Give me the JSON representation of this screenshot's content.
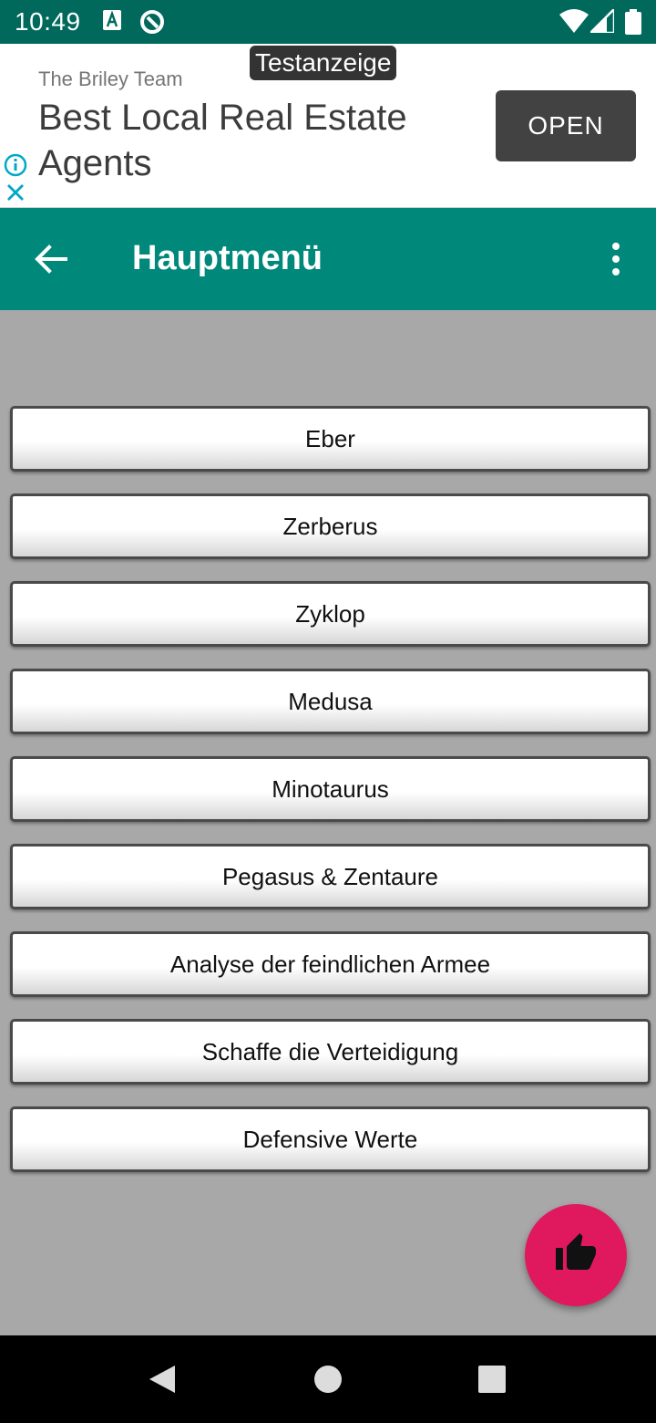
{
  "status_bar": {
    "time": "10:49",
    "icons": [
      "a-icon",
      "q-icon",
      "wifi-icon",
      "signal-icon",
      "battery-icon"
    ]
  },
  "ad": {
    "badge": "Testanzeige",
    "advertiser": "The Briley Team",
    "headline": "Best Local Real Estate Agents",
    "cta": "OPEN",
    "icons": [
      "info-icon",
      "close-icon"
    ]
  },
  "app_bar": {
    "title": "Hauptmenü",
    "icons": [
      "back-arrow-icon",
      "more-vert-icon"
    ],
    "color": "#00897b"
  },
  "menu": {
    "items": [
      "Eber",
      "Zerberus",
      "Zyklop",
      "Medusa",
      "Minotaurus",
      "Pegasus & Zentaure",
      "Analyse der feindlichen Armee",
      "Schaffe die Verteidigung",
      "Defensive Werte"
    ]
  },
  "fab": {
    "icon": "thumb-up-icon",
    "color": "#e0195f"
  },
  "nav_bar": {
    "icons": [
      "back-triangle-icon",
      "home-circle-icon",
      "recents-square-icon"
    ]
  }
}
